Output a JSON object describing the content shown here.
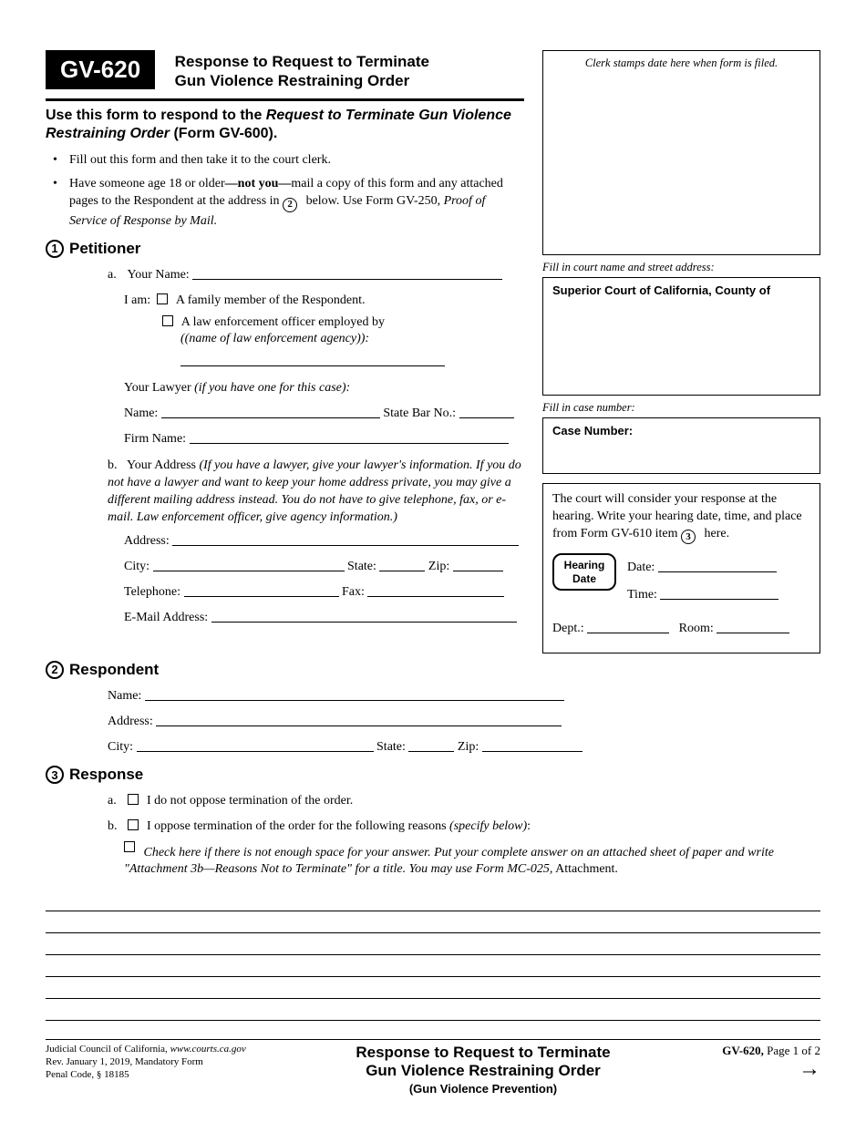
{
  "header": {
    "form_code": "GV-620",
    "title_l1": "Response to Request to Terminate",
    "title_l2": "Gun Violence Restraining Order"
  },
  "intro": {
    "line": "Use this form to respond to the ",
    "ital": "Request to Terminate Gun Violence Restraining Order",
    "tail": " (Form GV-600)."
  },
  "bullets": {
    "b1": "Fill out this form and then take it to the court clerk.",
    "b2a": "Have someone age 18 or older",
    "b2b": "—not you—",
    "b2c": "mail a copy of this form and any attached pages to the Respondent at the address in ",
    "b2d": " below. Use Form GV-250, ",
    "b2e": "Proof of Service of Response by Mail."
  },
  "section1": {
    "num": "1",
    "title": "Petitioner",
    "a_label": "a.",
    "your_name": "Your Name:",
    "iam": "I am:",
    "fam": "A family member of the Respondent.",
    "leo1": "A law enforcement officer employed by",
    "leo2": "(name of law enforcement agency)",
    "lawyer_head": "Your Lawyer ",
    "lawyer_ital": "(if you have one for this case):",
    "name": "Name:",
    "bar": "State Bar No.:",
    "firm": "Firm Name:",
    "b_label": "b.",
    "addr_head": "Your Address ",
    "addr_ital": "(If you have a lawyer, give your lawyer's information. If you do not have a lawyer and want to keep your home address private, you may give a different mailing address instead. You do not have to give telephone, fax, or e-mail. Law enforcement officer, give agency information.)",
    "address": "Address:",
    "city": "City:",
    "state": "State:",
    "zip": "Zip:",
    "tel": "Telephone:",
    "fax": "Fax:",
    "email": "E-Mail Address:"
  },
  "section2": {
    "num": "2",
    "title": "Respondent",
    "name": "Name:",
    "address": "Address:",
    "city": "City:",
    "state": "State:",
    "zip": "Zip:"
  },
  "section3": {
    "num": "3",
    "title": "Response",
    "a_label": "a.",
    "a_text": "I do not oppose termination of the order.",
    "b_label": "b.",
    "b_text1": "I oppose termination of the order for the following reasons ",
    "b_text2": "(specify below)",
    "attach1": "Check here if there is not enough space for your answer. Put your complete answer on an attached sheet of paper and write \"Attachment 3b—Reasons Not to Terminate\" for a title. You may use Form MC-025,",
    "attach2": " Attachment."
  },
  "right": {
    "clerk": "Clerk stamps date here when form is filed.",
    "court_label": "Fill in court name and street address:",
    "court_title": "Superior Court of California, County of",
    "case_label": "Fill in case number:",
    "case_title": "Case Number:",
    "hearing_text1": "The court will consider your response at the hearing. Write your hearing date, time, and place from Form GV-610 item ",
    "hearing_text2": " here.",
    "hearing_badge1": "Hearing",
    "hearing_badge2": "Date",
    "date": "Date:",
    "time": "Time:",
    "dept": "Dept.:",
    "room": "Room:",
    "circle3": "3"
  },
  "footer": {
    "l1": "Judicial Council of California, ",
    "l1i": "www.courts.ca.gov",
    "l2": "Rev. January 1, 2019, Mandatory Form",
    "l3": "Penal Code, § 18185",
    "center1": "Response to Request to Terminate",
    "center2": "Gun Violence Restraining Order",
    "center3": "(Gun Violence Prevention)",
    "right1": "GV-620,",
    "right2": " Page 1 of 2"
  },
  "circle2": "2"
}
